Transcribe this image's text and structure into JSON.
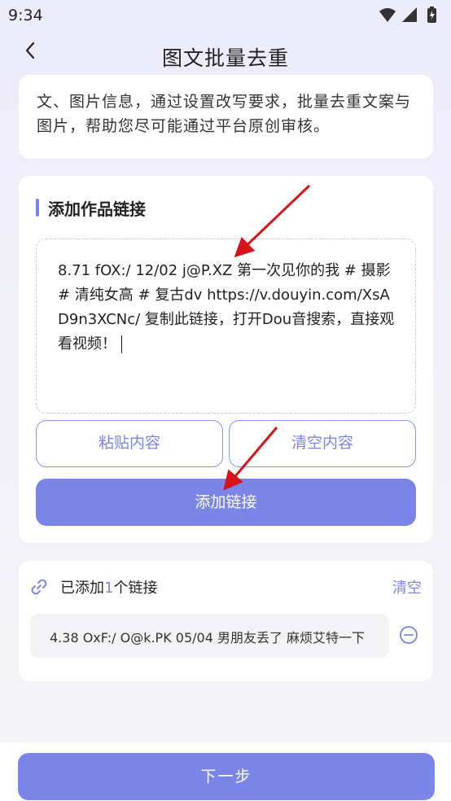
{
  "status_bar": {
    "time": "9:34",
    "icons": [
      "wifi-icon",
      "signal-icon",
      "battery-charging-icon"
    ]
  },
  "header": {
    "title": "图文批量去重",
    "back_icon": "chevron-left-icon"
  },
  "intro": {
    "text": "文、图片信息，通过设置改写要求，批量去重文案与图片，帮助您尽可能通过平台原创审核。"
  },
  "add_section": {
    "title": "添加作品链接",
    "input_value": "8.71 fOX:/ 12/02 j@P.XZ 第一次见你的我 # 摄影 # 清纯女高 # 复古dv  https://v.douyin.com/XsAD9n3XCNc/ 复制此链接，打开Dou音搜索，直接观看视频！",
    "paste_label": "粘贴内容",
    "clear_label": "清空内容",
    "add_label": "添加链接"
  },
  "added_list": {
    "prefix": "已添加",
    "count": "1",
    "suffix": "个链接",
    "clear_all_label": "清空",
    "items": [
      {
        "text": "4.38 OxF:/ O@k.PK 05/04 男朋友丢了 麻烦艾特一下"
      }
    ]
  },
  "footer": {
    "next_label": "下一步"
  },
  "colors": {
    "accent": "#7b85e8",
    "annotation_arrow": "#d7141a",
    "card": "#ffffff",
    "background": "#f1f0f8"
  }
}
